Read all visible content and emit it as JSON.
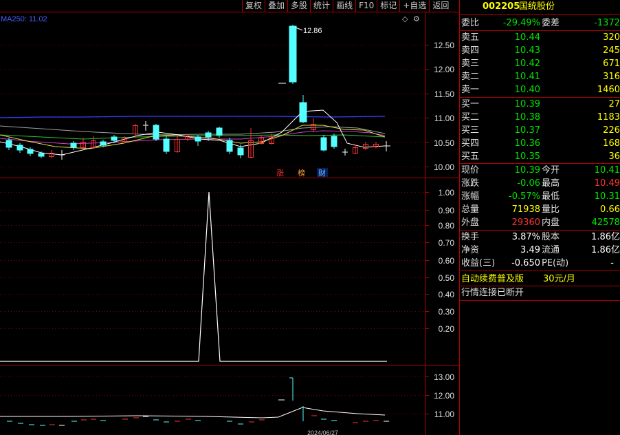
{
  "toolbar": {
    "buttons": [
      "复权",
      "叠加",
      "多股",
      "统计",
      "画线",
      "F10",
      "标记",
      "+自选",
      "返回"
    ]
  },
  "chart": {
    "ma_label": "MA250: 11.02",
    "peak_label": "12.86",
    "price_axis": [
      "12.50",
      "12.00",
      "11.50",
      "11.00",
      "10.50",
      "10.00"
    ],
    "markers": [
      "涨",
      "榜",
      "财"
    ],
    "indicator_axis": [
      "1.00",
      "0.90",
      "0.80",
      "0.70",
      "0.60",
      "0.50",
      "0.40",
      "0.30",
      "0.20"
    ],
    "lower_axis": [
      "13.00",
      "12.00",
      "11.00"
    ],
    "bottom_date": "2024/06/27"
  },
  "panel": {
    "code": "002205",
    "name": "国统股份",
    "weibi_label": "委比",
    "weibi": "-29.49%",
    "weicha_label": "委差",
    "weicha": "-1372",
    "asks": [
      {
        "label": "卖五",
        "price": "10.44",
        "vol": "320"
      },
      {
        "label": "卖四",
        "price": "10.43",
        "vol": "245"
      },
      {
        "label": "卖三",
        "price": "10.42",
        "vol": "671"
      },
      {
        "label": "卖二",
        "price": "10.41",
        "vol": "316"
      },
      {
        "label": "卖一",
        "price": "10.40",
        "vol": "1460"
      }
    ],
    "bids": [
      {
        "label": "买一",
        "price": "10.39",
        "vol": "27"
      },
      {
        "label": "买二",
        "price": "10.38",
        "vol": "1183"
      },
      {
        "label": "买三",
        "price": "10.37",
        "vol": "226"
      },
      {
        "label": "买四",
        "price": "10.36",
        "vol": "168"
      },
      {
        "label": "买五",
        "price": "10.35",
        "vol": "36"
      }
    ],
    "stats": [
      {
        "l1": "现价",
        "v1": "10.39",
        "l2": "今开",
        "v2": "10.41"
      },
      {
        "l1": "涨跌",
        "v1": "-0.06",
        "l2": "最高",
        "v2": "10.49"
      },
      {
        "l1": "涨幅",
        "v1": "-0.57%",
        "l2": "最低",
        "v2": "10.31"
      },
      {
        "l1": "总量",
        "v1": "71938",
        "l2": "量比",
        "v2": "0.66"
      },
      {
        "l1": "外盘",
        "v1": "29360",
        "l2": "内盘",
        "v2": "42578"
      }
    ],
    "fund": [
      {
        "l1": "换手",
        "v1": "3.87%",
        "l2": "股本",
        "v2": "1.86亿"
      },
      {
        "l1": "净资",
        "v1": "3.49",
        "l2": "流通",
        "v2": "1.86亿"
      },
      {
        "l1": "收益(三)",
        "v1": "-0.650",
        "l2": "PE(动)",
        "v2": "-"
      }
    ],
    "promo_text": "自动续费普及版",
    "promo_price": "30元/月",
    "status": "行情连接已断开"
  },
  "colors": {
    "up": "#ff3232",
    "down": "#54ffff",
    "green": "#00e600",
    "yellow": "#ffff00",
    "grid": "#b00000",
    "white": "#ffffff"
  }
}
